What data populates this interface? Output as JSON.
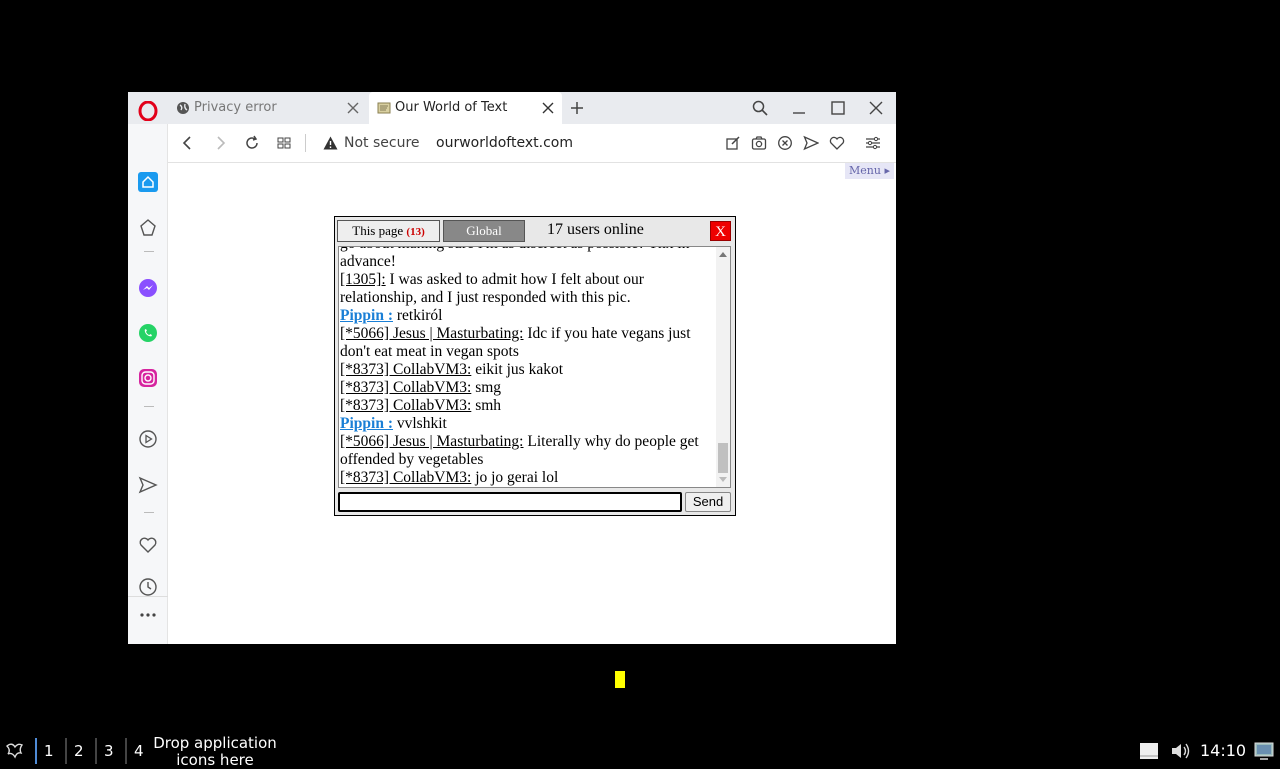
{
  "browser": {
    "tabs": [
      {
        "title": "Privacy error",
        "icon": "globe-icon",
        "active": false
      },
      {
        "title": "Our World of Text",
        "icon": "owot-favicon-icon",
        "active": true
      }
    ],
    "security_label": "Not secure",
    "url": "ourworldoftext.com"
  },
  "page": {
    "menu_label": "Menu"
  },
  "chat": {
    "tab_page_label": "This page",
    "tab_page_count": "(13)",
    "tab_global_label": "Global",
    "online_text": "17 users online",
    "close_label": "X",
    "send_label": "Send",
    "input_value": "",
    "messages": [
      {
        "nick": "",
        "text": "go about making sure I'm as discreet as possible? Thx in advance!"
      },
      {
        "nick": "[1305]:",
        "text": " I was asked to admit how I felt about our relationship, and I just responded with this pic."
      },
      {
        "nick": " Pippin :",
        "text": " retkiról",
        "highlight": true
      },
      {
        "nick": "[*5066] Jesus | Masturbating:",
        "text": " Idc if you hate vegans just don't eat meat in vegan spots"
      },
      {
        "nick": "[*8373] CollabVM3:",
        "text": " eikit jus kakot"
      },
      {
        "nick": "[*8373] CollabVM3:",
        "text": " smg"
      },
      {
        "nick": "[*8373] CollabVM3:",
        "text": " smh"
      },
      {
        "nick": " Pippin :",
        "text": " vvlshkit",
        "highlight": true
      },
      {
        "nick": "[*5066] Jesus | Masturbating:",
        "text": " Literally why do people get offended by vegetables"
      },
      {
        "nick": "[*8373] CollabVM3:",
        "text": " jo jo gerai lol"
      }
    ]
  },
  "taskbar": {
    "workspaces": [
      "1",
      "2",
      "3",
      "4"
    ],
    "drop_text": "Drop application icons here",
    "clock": "14:10"
  },
  "colors": {
    "opera_red": "#e2001a",
    "chat_close": "#ee0000",
    "nick_highlight": "#1a7fd6",
    "cursor": "#ffff00"
  }
}
